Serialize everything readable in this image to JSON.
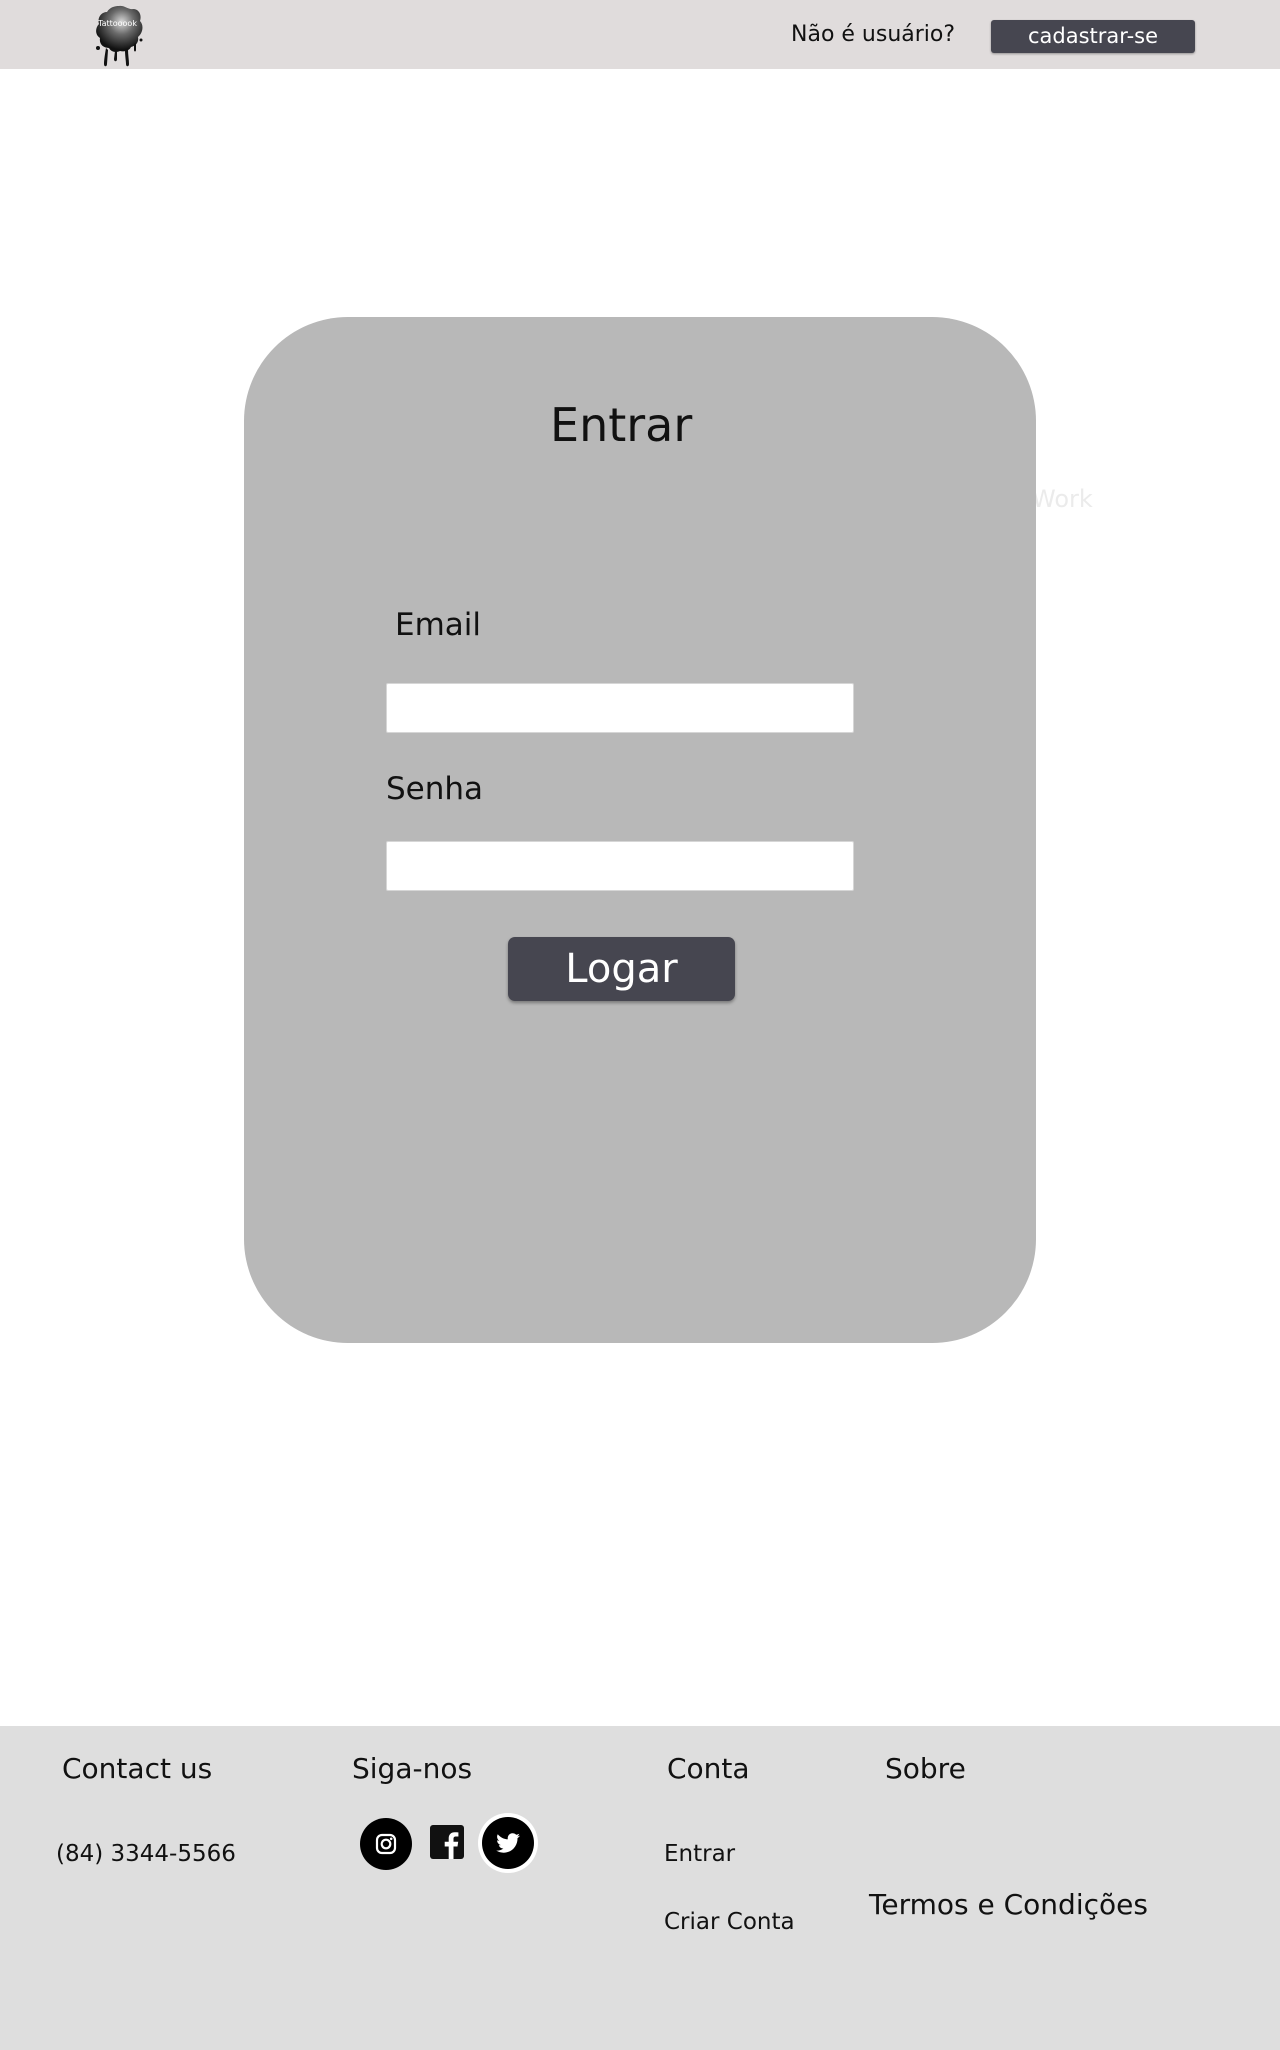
{
  "header": {
    "logo_text": "Tattooook",
    "prompt_text": "Não é usuário?",
    "signup_label": "cadastrar-se"
  },
  "login": {
    "title": "Entrar",
    "background_text": "Work",
    "email_label": "Email",
    "email_value": "",
    "password_label": "Senha",
    "password_value": "",
    "submit_label": "Logar"
  },
  "footer": {
    "contact": {
      "heading": "Contact us",
      "phone": "(84) 3344-5566"
    },
    "follow": {
      "heading": "Siga-nos",
      "icons": [
        "instagram-icon",
        "facebook-icon",
        "twitter-icon"
      ]
    },
    "account": {
      "heading": "Conta",
      "links": [
        "Entrar",
        "Criar Conta"
      ]
    },
    "about": {
      "heading": "Sobre",
      "links": [
        "Termos e Condições"
      ]
    }
  },
  "colors": {
    "header_bg": "#e0dcdc",
    "button_bg": "#464650",
    "card_bg": "#b8b8b8",
    "footer_bg": "#dedede"
  }
}
